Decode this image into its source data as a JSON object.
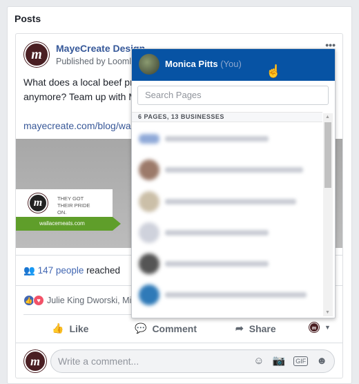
{
  "section_title": "Posts",
  "post": {
    "page_name": "MayeCreate Design",
    "published_by": "Published by Loomly",
    "text": "What does a local beef producer do when their website isn’t cutting it anymore? Team up with MayeCreate so they can grow their business.",
    "link": "mayecreate.com/blog/wallace-meats",
    "image": {
      "tagline": "THEY GOT THEIR PRIDE ON.",
      "url": "wallacemeats.com"
    },
    "reach_count": "147 people",
    "reach_suffix": "reached",
    "reactions_text": "Julie King Dworski, Mike and others",
    "actions": {
      "like": "Like",
      "comment": "Comment",
      "share": "Share"
    },
    "comment_placeholder": "Write a comment...",
    "gif_label": "GIF"
  },
  "dropdown": {
    "user_name": "Monica Pitts",
    "user_suffix": "(You)",
    "search_placeholder": "Search Pages",
    "section_label": "6 PAGES, 13 BUSINESSES",
    "items_blurred": true
  },
  "colors": {
    "header": "#0753a4",
    "link": "#385898",
    "like": "#4267b2",
    "love": "#f25268"
  }
}
